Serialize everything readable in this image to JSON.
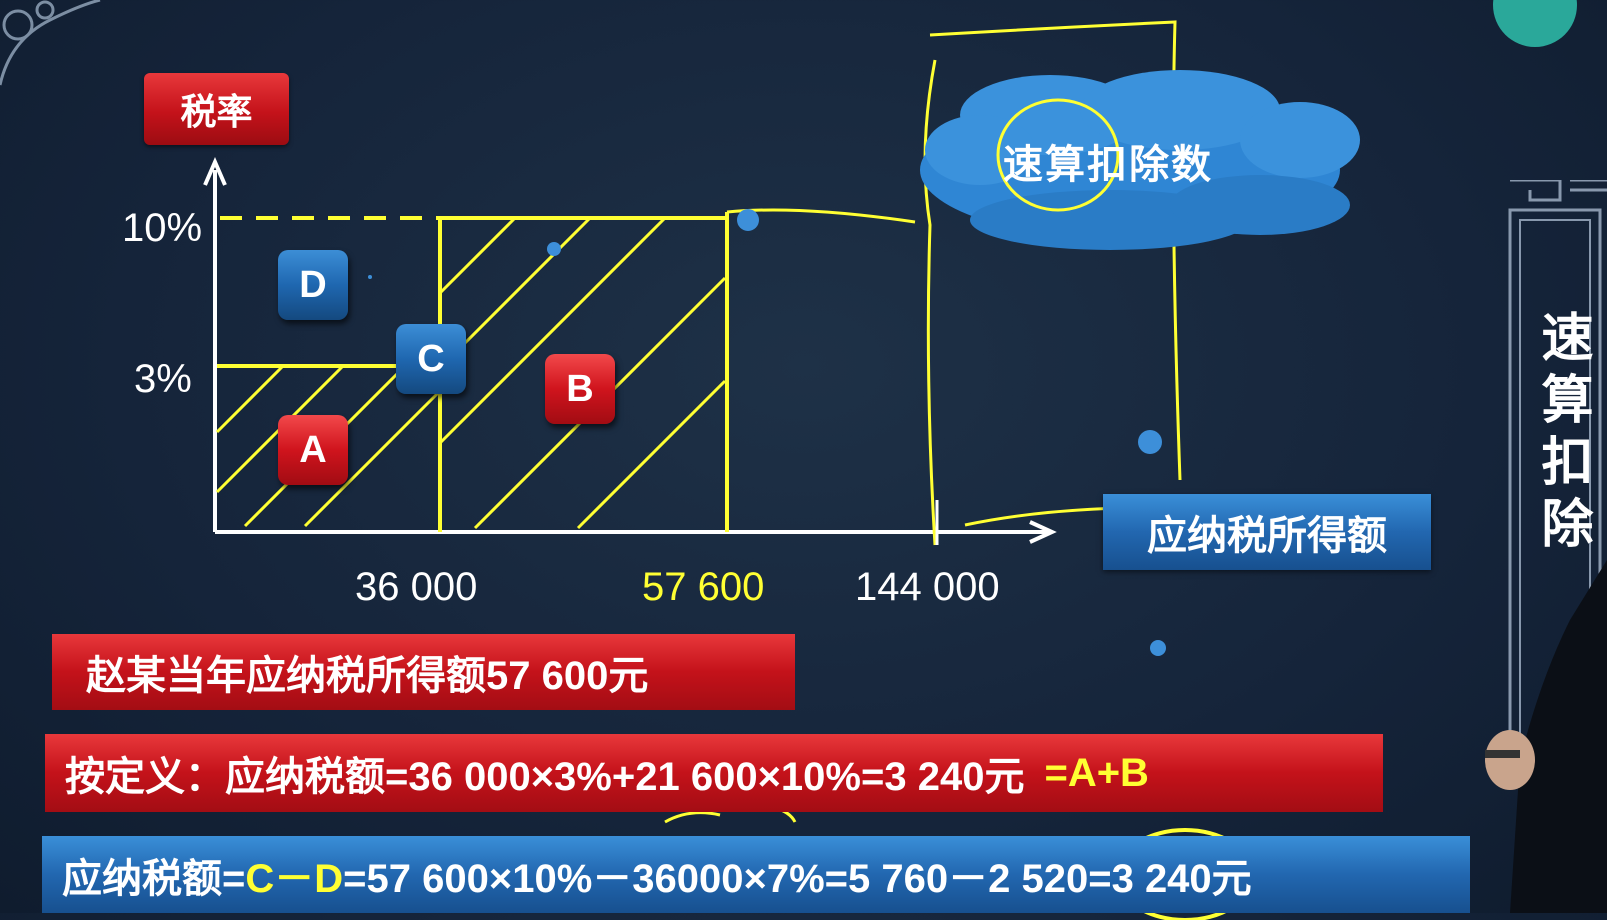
{
  "y_axis_title": "税率",
  "x_axis_title": "应纳税所得额",
  "y_ticks": [
    "10%",
    "3%"
  ],
  "x_ticks": [
    "36 000",
    "57 600",
    "144 000"
  ],
  "regions": [
    "A",
    "B",
    "C",
    "D"
  ],
  "cloud_label": "速算扣除数",
  "side_title": "速算扣除",
  "banner1": "赵某当年应纳税所得额57 600元",
  "banner2": {
    "text": "按定义：应纳税额=36 000×3%+21 600×10%=3 240元",
    "highlight": "=A+B"
  },
  "banner3": {
    "prefix": "应纳税额=",
    "highlight": "C－D",
    "text": "=57 600×10%－36000×7%=5 760－2 520=3 240元"
  },
  "colors": {
    "accent_yellow": "#ffff33",
    "label_red": "#c4121a",
    "label_blue": "#2267b0",
    "background": "#15243a"
  }
}
